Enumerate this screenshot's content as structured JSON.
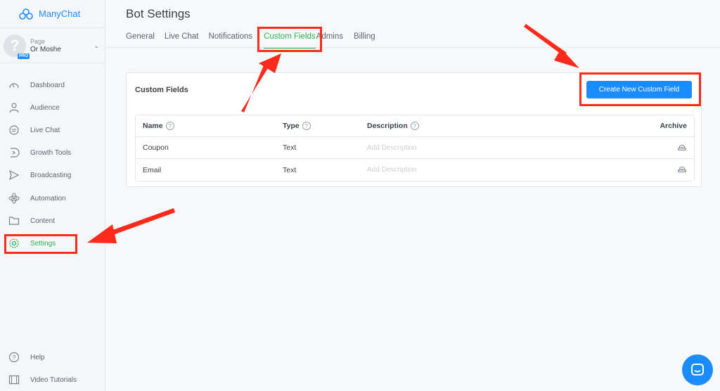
{
  "app": {
    "name": "ManyChat"
  },
  "page_selector": {
    "label": "Page",
    "name": "Or Moshe",
    "badge": "PRO",
    "avatar": "?"
  },
  "sidebar": {
    "items": [
      {
        "label": "Dashboard",
        "icon": "dashboard-icon"
      },
      {
        "label": "Audience",
        "icon": "audience-icon"
      },
      {
        "label": "Live Chat",
        "icon": "live-chat-icon"
      },
      {
        "label": "Growth Tools",
        "icon": "growth-tools-icon"
      },
      {
        "label": "Broadcasting",
        "icon": "broadcasting-icon"
      },
      {
        "label": "Automation",
        "icon": "automation-icon"
      },
      {
        "label": "Content",
        "icon": "content-icon"
      },
      {
        "label": "Settings",
        "icon": "settings-icon",
        "active": true
      }
    ],
    "bottom": [
      {
        "label": "Help",
        "icon": "help-icon"
      },
      {
        "label": "Video Tutorials",
        "icon": "video-icon"
      }
    ]
  },
  "main": {
    "title": "Bot Settings",
    "tabs": [
      {
        "label": "General"
      },
      {
        "label": "Live Chat"
      },
      {
        "label": "Notifications"
      },
      {
        "label": "Custom Fields",
        "active": true
      },
      {
        "label": "Admins"
      },
      {
        "label": "Billing"
      }
    ],
    "card": {
      "title": "Custom Fields",
      "create_button": "Create New Custom Field",
      "columns": [
        "Name",
        "Type",
        "Description",
        "Archive"
      ],
      "rows": [
        {
          "name": "Coupon",
          "type": "Text",
          "description_placeholder": "Add Description"
        },
        {
          "name": "Email",
          "type": "Text",
          "description_placeholder": "Add Description"
        }
      ]
    }
  },
  "colors": {
    "accent_green": "#2ab24b",
    "accent_blue": "#1a8cff",
    "annotation_red": "#ff2a1a"
  }
}
